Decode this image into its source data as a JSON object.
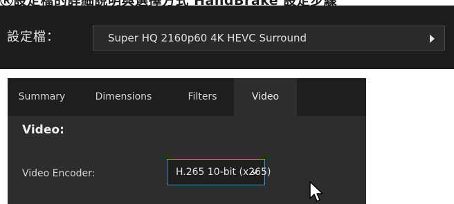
{
  "header_strip": {
    "cut_text": "Ⓡ設定檔的詳細說明與選擇方式 HandBrake 設定步驟"
  },
  "profile": {
    "label": "設定檔：",
    "selected": "Super HQ 2160p60 4K HEVC Surround",
    "arrow_icon": "triangle-right-icon"
  },
  "tabs": [
    {
      "label": "Summary",
      "active": false
    },
    {
      "label": "Dimensions",
      "active": false
    },
    {
      "label": "Filters",
      "active": false
    },
    {
      "label": "Video",
      "active": true
    }
  ],
  "video": {
    "section_title": "Video:",
    "encoder_label": "Video Encoder:",
    "encoder_value": "H.265 10-bit (x265)",
    "chevron_icon": "chevron-down-icon"
  },
  "cursor": {
    "icon": "mouse-pointer-icon"
  },
  "colors": {
    "panel_dark": "#1d1d1d",
    "panel_mid": "#2d2d2d",
    "focus_border": "#4a8fd8",
    "text": "#e0e0e0"
  }
}
